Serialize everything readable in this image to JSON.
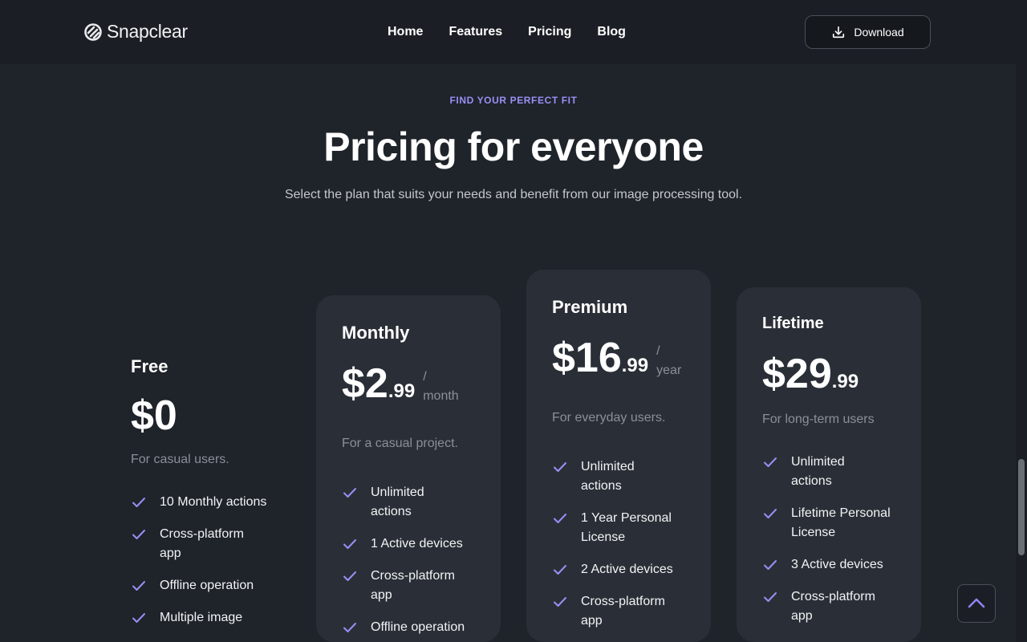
{
  "brand": {
    "name": "Snapclear"
  },
  "nav": {
    "items": [
      "Home",
      "Features",
      "Pricing",
      "Blog"
    ]
  },
  "header": {
    "download_label": "Download"
  },
  "hero": {
    "eyebrow": "FIND YOUR PERFECT FIT",
    "title": "Pricing for everyone",
    "subtitle": "Select the plan that suits your needs and benefit from our image processing tool."
  },
  "plans": [
    {
      "name": "Free",
      "price_main": "$0",
      "price_cents": "",
      "period_slash": "",
      "period": "",
      "description": "For casual users.",
      "features": [
        "10 Monthly actions",
        "Cross-platform app",
        "Offline operation",
        "Multiple image"
      ]
    },
    {
      "name": "Monthly",
      "price_main": "$2",
      "price_cents": ".99",
      "period_slash": "/",
      "period": "month",
      "description": "For a casual project.",
      "features": [
        "Unlimited actions",
        "1 Active devices",
        "Cross-platform app",
        "Offline operation"
      ]
    },
    {
      "name": "Premium",
      "price_main": "$16",
      "price_cents": ".99",
      "period_slash": "/",
      "period": "year",
      "description": "For everyday users.",
      "features": [
        "Unlimited actions",
        "1 Year Personal License",
        "2 Active devices",
        "Cross-platform app"
      ]
    },
    {
      "name": "Lifetime",
      "price_main": "$29",
      "price_cents": ".99",
      "period_slash": "",
      "period": "",
      "description": "For long-term users",
      "features": [
        "Unlimited actions",
        "Lifetime Personal License",
        "3 Active devices",
        "Cross-platform app"
      ]
    }
  ],
  "colors": {
    "accent": "#9a8ff5",
    "background": "#1f232a",
    "card": "#2a2f37"
  },
  "icons": {
    "download": "download-icon",
    "check": "check-icon",
    "scroll_top": "chevron-up-icon"
  }
}
